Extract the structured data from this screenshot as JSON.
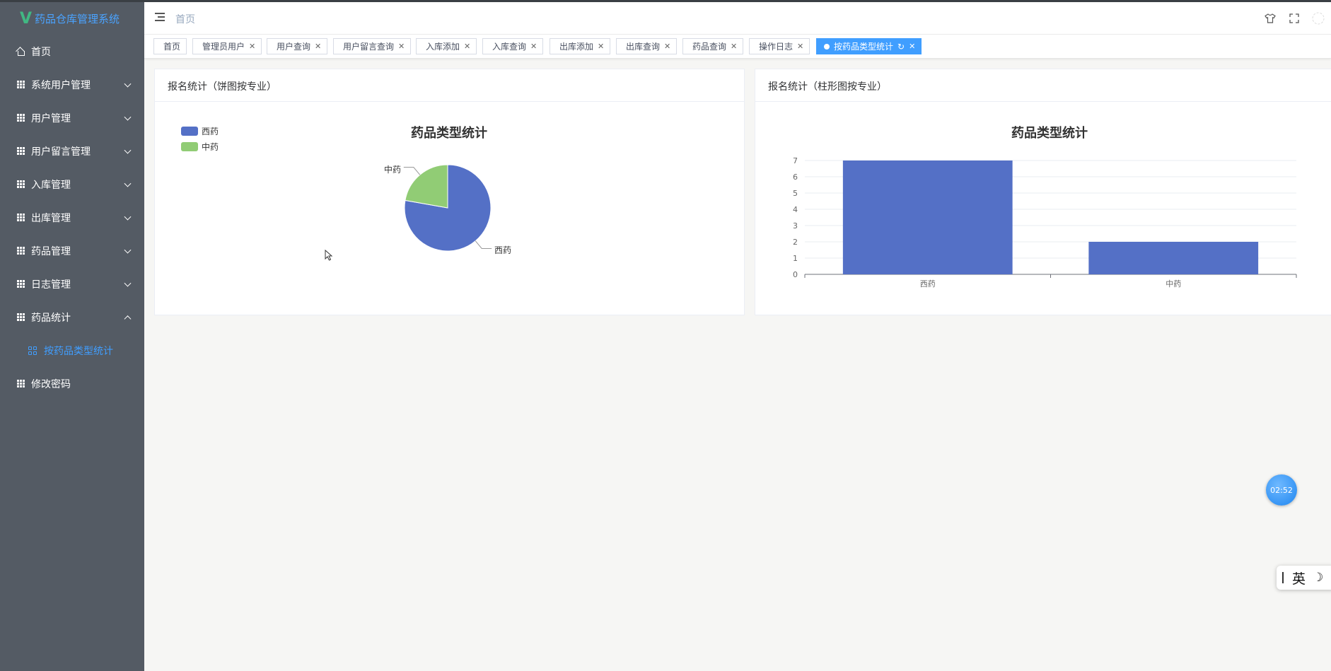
{
  "app": {
    "logo_mark": "V",
    "title": "药品仓库管理系统"
  },
  "sidebar": {
    "items": [
      {
        "label": "首页"
      },
      {
        "label": "系统用户管理"
      },
      {
        "label": "用户管理"
      },
      {
        "label": "用户留言管理"
      },
      {
        "label": "入库管理"
      },
      {
        "label": "出库管理"
      },
      {
        "label": "药品管理"
      },
      {
        "label": "日志管理"
      },
      {
        "label": "药品统计"
      },
      {
        "label": "按药品类型统计"
      },
      {
        "label": "修改密码"
      }
    ]
  },
  "navbar": {
    "breadcrumb": "首页"
  },
  "tabs": [
    {
      "label": "首页"
    },
    {
      "label": "管理员用户"
    },
    {
      "label": "用户查询"
    },
    {
      "label": "用户留言查询"
    },
    {
      "label": "入库添加"
    },
    {
      "label": "入库查询"
    },
    {
      "label": "出库添加"
    },
    {
      "label": "出库查询"
    },
    {
      "label": "药品查询"
    },
    {
      "label": "操作日志"
    },
    {
      "label": "按药品类型统计"
    }
  ],
  "cards": {
    "pie_header": "报名统计（饼图按专业）",
    "bar_header": "报名统计（柱形图按专业）"
  },
  "chart_data": [
    {
      "type": "pie",
      "title": "药品类型统计",
      "categories": [
        "西药",
        "中药"
      ],
      "values": [
        7,
        2
      ],
      "colors": [
        "#5470c6",
        "#91cc75"
      ],
      "legend": [
        "西药",
        "中药"
      ],
      "legend_position": "top-left"
    },
    {
      "type": "bar",
      "title": "药品类型统计",
      "categories": [
        "西药",
        "中药"
      ],
      "values": [
        7,
        2
      ],
      "ylim": [
        0,
        7
      ],
      "yticks": [
        "0",
        "1",
        "2",
        "3",
        "4",
        "5",
        "6",
        "7"
      ],
      "color": "#5470c6",
      "grid": true
    }
  ],
  "overlays": {
    "timer": "02:52",
    "ime_label": "英"
  },
  "colors": {
    "sidebar_bg": "#545b64",
    "accent": "#409eff",
    "series_blue": "#5470c6",
    "series_green": "#91cc75"
  }
}
